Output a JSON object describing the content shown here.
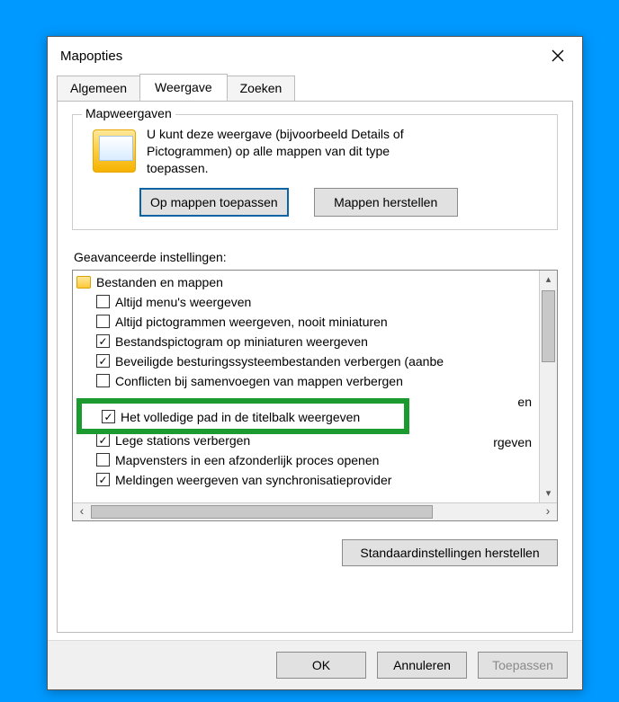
{
  "dialog": {
    "title": "Mapopties",
    "tabs": {
      "general": "Algemeen",
      "view": "Weergave",
      "search": "Zoeken"
    },
    "group": {
      "legend": "Mapweergaven",
      "text_l1": "U kunt deze weergave (bijvoorbeeld Details of",
      "text_l2": "Pictogrammen) op alle mappen van dit type",
      "text_l3": "toepassen.",
      "apply_btn": "Op mappen toepassen",
      "reset_btn": "Mappen herstellen"
    },
    "advanced_label": "Geavanceerde instellingen:",
    "tree": {
      "root": "Bestanden en mappen",
      "items": [
        {
          "checked": false,
          "label": "Altijd menu's weergeven"
        },
        {
          "checked": false,
          "label": "Altijd pictogrammen weergeven, nooit miniaturen"
        },
        {
          "checked": true,
          "label": "Bestandspictogram op miniaturen weergeven"
        },
        {
          "checked": true,
          "label": "Beveiligde besturingssysteembestanden verbergen (aanbe"
        },
        {
          "checked": false,
          "label": "Conflicten bij samenvoegen van mappen verbergen"
        },
        {
          "checked": true,
          "label": "Het volledige pad in de titelbalk weergeven"
        },
        {
          "checked": true,
          "label": "Lege stations verbergen"
        },
        {
          "checked": false,
          "label": "Mapvensters in een afzonderlijk proces openen"
        },
        {
          "checked": true,
          "label": "Meldingen weergeven van synchronisatieprovider"
        }
      ],
      "partial_above_tail": "en",
      "partial_below_tail": "rgeven"
    },
    "restore_defaults": "Standaardinstellingen herstellen",
    "buttons": {
      "ok": "OK",
      "cancel": "Annuleren",
      "apply": "Toepassen"
    }
  }
}
